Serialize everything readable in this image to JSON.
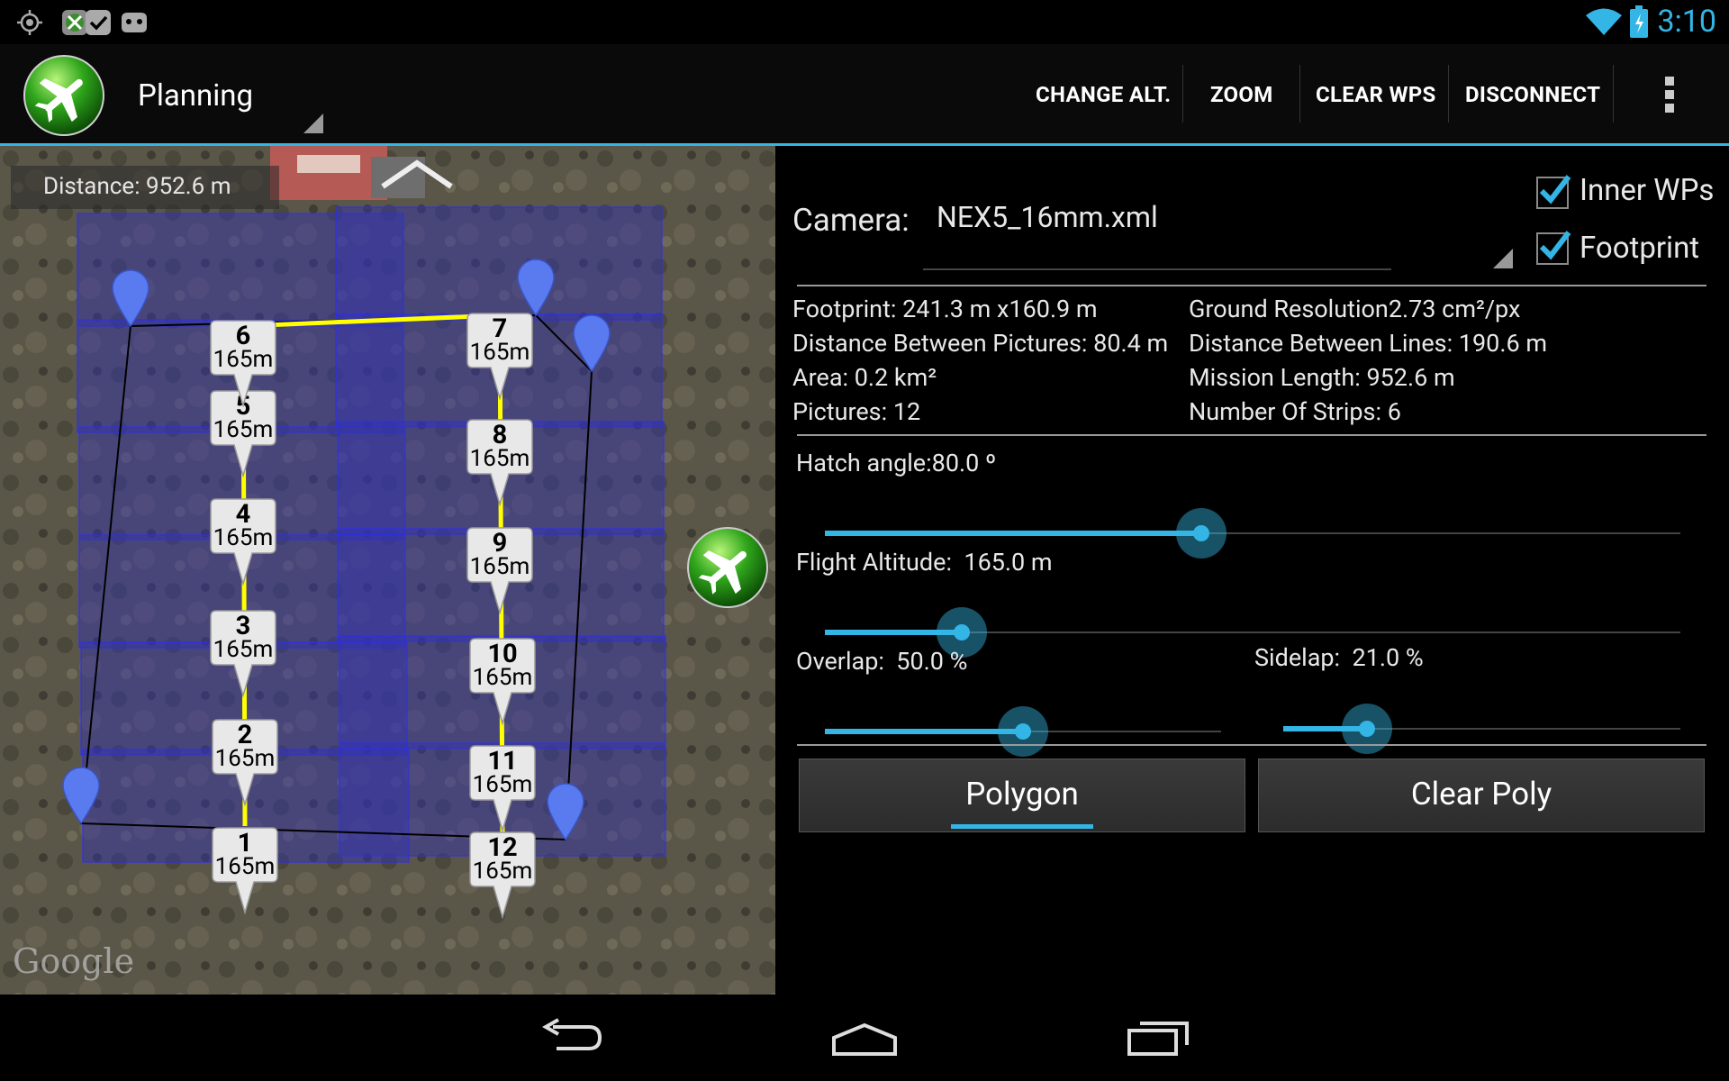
{
  "status_bar": {
    "time": "3:10",
    "icons": [
      "gps-icon",
      "app-notification-icon",
      "check-icon",
      "gamepad-icon",
      "wifi-icon",
      "battery-icon"
    ]
  },
  "action_bar": {
    "title": "Planning",
    "actions": [
      "CHANGE ALT.",
      "ZOOM",
      "CLEAR WPS",
      "DISCONNECT"
    ],
    "overflow_icon": "more-vert-icon"
  },
  "map": {
    "distance_label": "Distance: 952.6 m",
    "attribution": "Google",
    "waypoints": [
      {
        "num": "1",
        "alt": "165m"
      },
      {
        "num": "2",
        "alt": "165m"
      },
      {
        "num": "3",
        "alt": "165m"
      },
      {
        "num": "4",
        "alt": "165m"
      },
      {
        "num": "5",
        "alt": "165m"
      },
      {
        "num": "6",
        "alt": "165m"
      },
      {
        "num": "7",
        "alt": "165m"
      },
      {
        "num": "8",
        "alt": "165m"
      },
      {
        "num": "9",
        "alt": "165m"
      },
      {
        "num": "10",
        "alt": "165m"
      },
      {
        "num": "11",
        "alt": "165m"
      },
      {
        "num": "12",
        "alt": "165m"
      }
    ]
  },
  "panel": {
    "camera_label": "Camera:",
    "camera_value": "NEX5_16mm.xml",
    "inner_wps_label": "Inner WPs",
    "inner_wps_checked": true,
    "footprint_label": "Footprint",
    "footprint_checked": true,
    "stats": {
      "footprint": "Footprint: 241.3 m x160.9 m",
      "ground_resolution": "Ground Resolution2.73 cm²/px",
      "distance_between_pictures": "Distance Between Pictures: 80.4 m",
      "distance_between_lines": "Distance Between Lines: 190.6 m",
      "area": "Area: 0.2 km²",
      "mission_length": "Mission Length: 952.6 m",
      "pictures": "Pictures: 12",
      "number_of_strips": "Number Of Strips: 6"
    },
    "hatch_angle_label": "Hatch angle:80.0 º",
    "hatch_angle_fraction": 0.44,
    "flight_altitude_label": "Flight Altitude:  165.0 m",
    "flight_altitude_fraction": 0.16,
    "overlap_label": "Overlap:  50.0 %",
    "overlap_fraction": 0.5,
    "sidelap_label": "Sidelap:  21.0 %",
    "sidelap_fraction": 0.21,
    "polygon_button": "Polygon",
    "clear_poly_button": "Clear Poly"
  },
  "colors": {
    "accent": "#33b5e5",
    "path": "#ffff00",
    "footprint": "#3232b4"
  }
}
